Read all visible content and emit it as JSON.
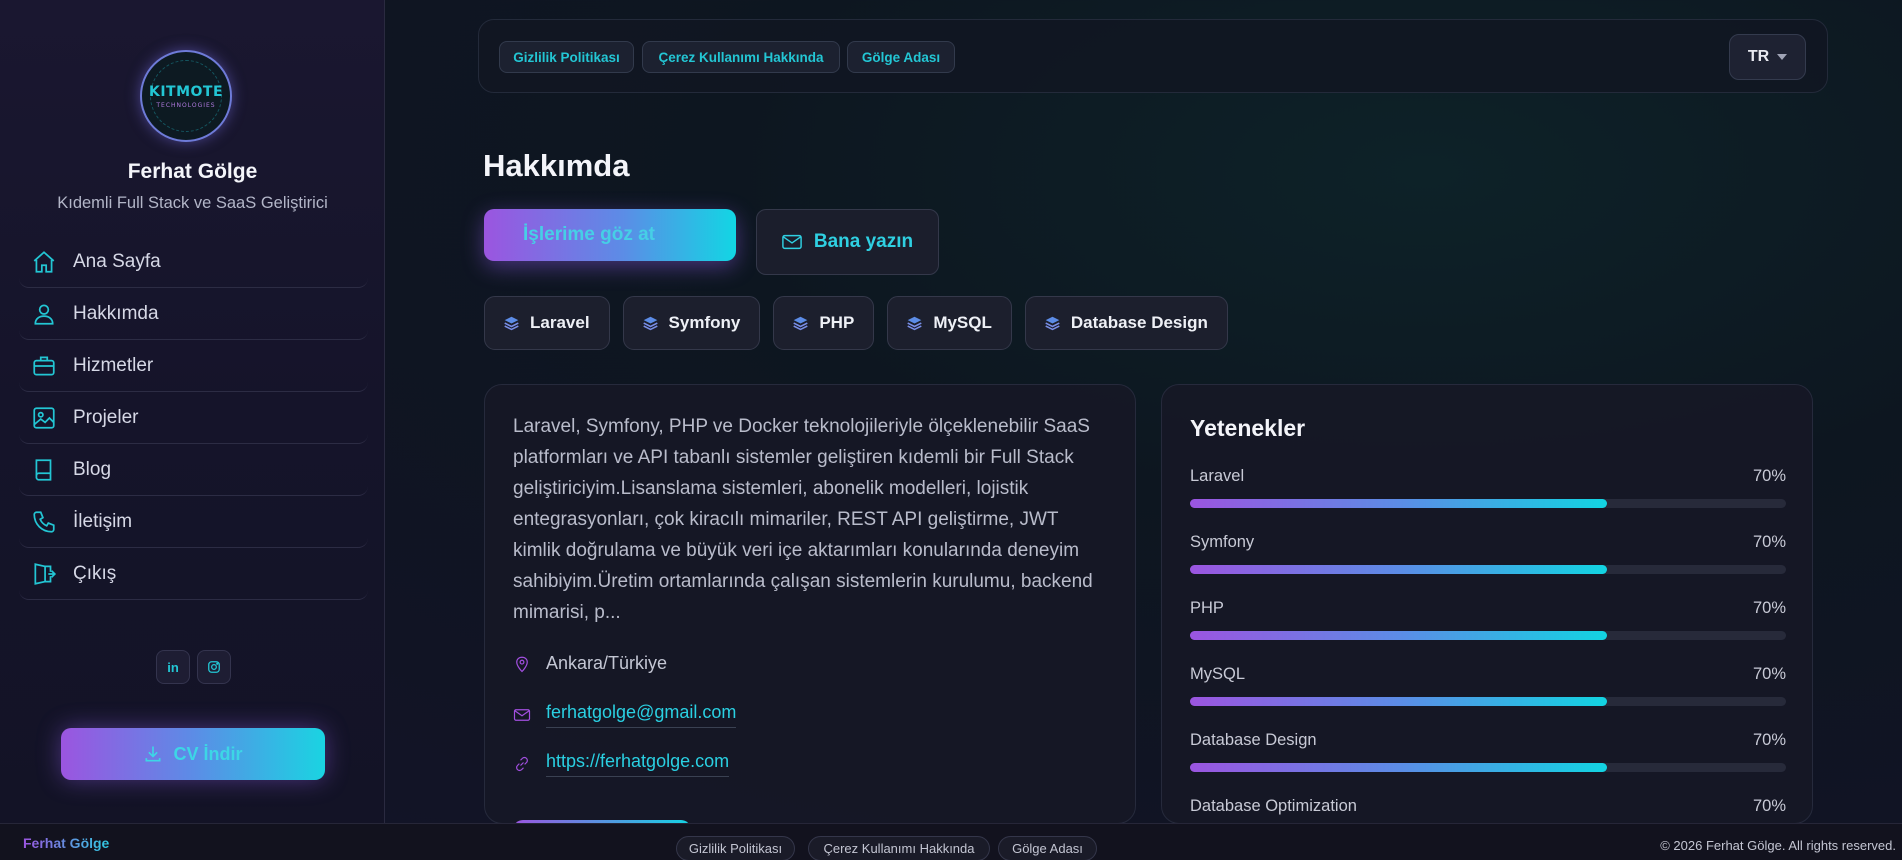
{
  "sidebar": {
    "logo": {
      "line1": "KITMOTE",
      "line2": "TECHNOLOGIES"
    },
    "name": "Ferhat Gölge",
    "title": "Kıdemli Full Stack ve SaaS Geliştirici",
    "nav": [
      {
        "label": "Ana Sayfa",
        "icon": "home-icon"
      },
      {
        "label": "Hakkımda",
        "icon": "user-icon"
      },
      {
        "label": "Hizmetler",
        "icon": "briefcase-icon"
      },
      {
        "label": "Projeler",
        "icon": "image-icon"
      },
      {
        "label": "Blog",
        "icon": "book-icon"
      },
      {
        "label": "İletişim",
        "icon": "phone-icon"
      },
      {
        "label": "Çıkış",
        "icon": "logout-icon"
      }
    ],
    "socials": [
      {
        "label": "in",
        "icon": "linkedin-icon"
      },
      {
        "label": "",
        "icon": "instagram-icon"
      }
    ],
    "cv_button": "CV İndir"
  },
  "topbar": {
    "links": [
      "Gizlilik Politikası",
      "Çerez Kullanımı Hakkında",
      "Gölge Adası"
    ],
    "lang": "TR"
  },
  "main": {
    "title": "Hakkımda",
    "primary_button": "İşlerime göz at",
    "secondary_button": "Bana yazın",
    "chips": [
      "Laravel",
      "Symfony",
      "PHP",
      "MySQL",
      "Database Design"
    ],
    "about_text": "Laravel, Symfony, PHP ve Docker teknolojileriyle ölçeklenebilir SaaS platformları ve API tabanlı sistemler geliştiren kıdemli bir Full Stack geliştiriciyim.Lisanslama sistemleri, abonelik modelleri, lojistik entegrasyonları, çok kiracılı mimariler, REST API geliştirme, JWT kimlik doğrulama ve büyük veri içe aktarımları konularında deneyim sahibiyim.Üretim ortamlarında çalışan sistemlerin kurulumu, backend mimarisi, p...",
    "location": "Ankara/Türkiye",
    "email": "ferhatgolge@gmail.com",
    "website": "https://ferhatgolge.com"
  },
  "skills": {
    "title": "Yetenekler",
    "items": [
      {
        "name": "Laravel",
        "percent_label": "70%",
        "level": 0.7
      },
      {
        "name": "Symfony",
        "percent_label": "70%",
        "level": 0.7
      },
      {
        "name": "PHP",
        "percent_label": "70%",
        "level": 0.7
      },
      {
        "name": "MySQL",
        "percent_label": "70%",
        "level": 0.7
      },
      {
        "name": "Database Design",
        "percent_label": "70%",
        "level": 0.7
      },
      {
        "name": "Database Optimization",
        "percent_label": "70%",
        "level": 0.7
      }
    ]
  },
  "footer": {
    "brand": "Ferhat Gölge",
    "links": [
      "Gizlilik Politikası",
      "Çerez Kullanımı Hakkında",
      "Gölge Adası"
    ],
    "copyright": "© 2026 Ferhat Gölge. All rights reserved."
  },
  "colors": {
    "accent_cyan": "#23c6d4",
    "accent_purple": "#9b55e0",
    "background": "#111424"
  }
}
